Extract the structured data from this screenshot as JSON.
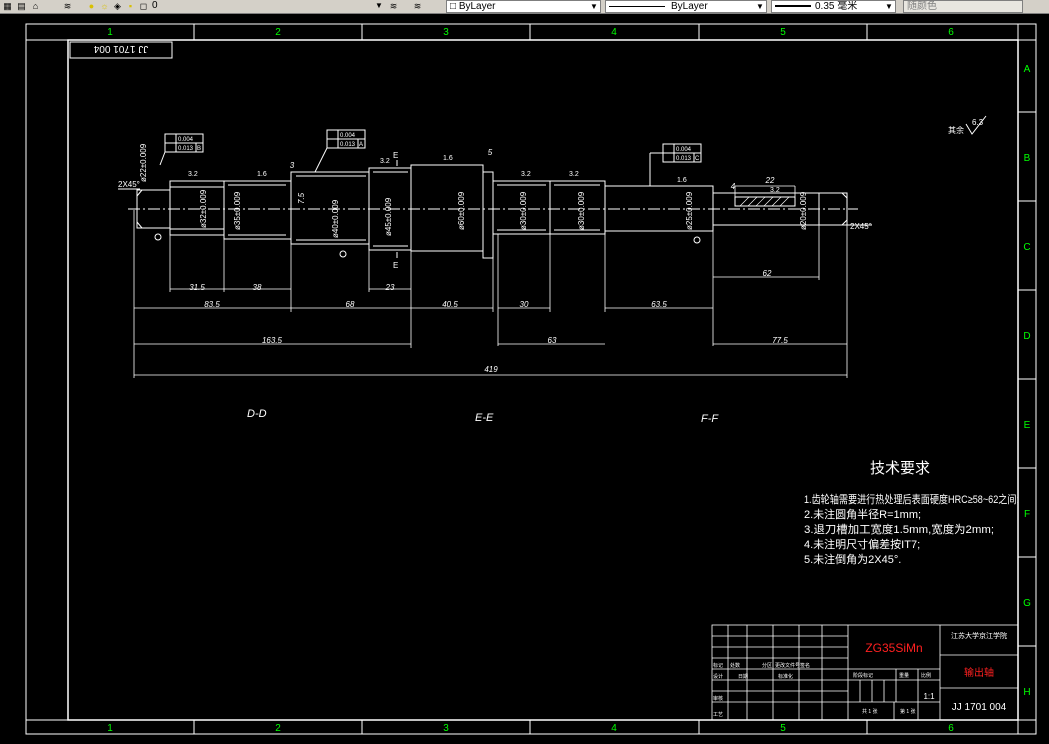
{
  "toolbar": {
    "layer_name": "0",
    "color_value": "ByLayer",
    "linetype_value": "ByLayer",
    "lineweight_value": "0.35 毫米",
    "plotstyle_value": "随颜色",
    "icons": [
      "layer-manager-icon",
      "lightbulb-icon",
      "sun-icon",
      "layer-color-icon",
      "lock-icon",
      "layer-previous-icon",
      "layer-tool-icon",
      "color-swatch-icon"
    ]
  },
  "border": {
    "columns": [
      "1",
      "2",
      "3",
      "4",
      "5",
      "6"
    ],
    "rows": [
      "A",
      "B",
      "C",
      "D",
      "E",
      "F",
      "G",
      "H"
    ]
  },
  "drawing": {
    "drawing_number_rotated": "JJ 1701 004",
    "surface_note": "其余",
    "surface_roughness": "6.3",
    "section_labels": [
      "D-D",
      "E-E",
      "F-F"
    ],
    "chamfer_left": "2X45°",
    "chamfer_right": "2X45°",
    "diameters": [
      "ø22±0.009",
      "ø32±0.009",
      "ø35±0.009",
      "ø40±0.009",
      "ø45±0.009",
      "ø60±0.009",
      "ø30±0.009",
      "ø30±0.009",
      "ø25±0.009",
      "ø20±0.009"
    ],
    "tolerance_frames": [
      {
        "values": [
          "0.004",
          "0.013"
        ],
        "datum": "B"
      },
      {
        "values": [
          "0.004",
          "0.013"
        ],
        "datum": "A"
      },
      {
        "values": [
          "0.004",
          "0.013"
        ],
        "datum": "C"
      }
    ],
    "dimensions": {
      "d31_5": "31.5",
      "d38": "38",
      "d83_5": "83.5",
      "d68": "68",
      "d23": "23",
      "d40_5": "40.5",
      "d30": "30",
      "d63_5": "63.5",
      "d163_5": "163.5",
      "d63": "63",
      "d77_5": "77.5",
      "d419": "419",
      "d62": "62",
      "d22": "22",
      "d7_5": "7.5",
      "d5": "5",
      "d3": "3",
      "d4": "4"
    },
    "roughness_marks": [
      "3.2",
      "1.6",
      "3.2",
      "1.6",
      "3.2",
      "3.2",
      "1.6",
      "3.2"
    ],
    "section_marks": [
      "E",
      "E"
    ]
  },
  "tech_requirements": {
    "title": "技术要求",
    "items": [
      "1.齿轮轴需要进行热处理后表面硬度HRC≥58~62之间;",
      "2.未注圆角半径R=1mm;",
      "3.退刀槽加工宽度1.5mm,宽度为2mm;",
      "4.未注明尺寸偏差按IT7;",
      "5.未注倒角为2X45°."
    ]
  },
  "title_block": {
    "material": "ZG35SiMn",
    "school": "江苏大学京江学院",
    "part_name": "输出轴",
    "drawing_number": "JJ 1701 004",
    "scale": "1:1",
    "row_labels": [
      "标记",
      "设计",
      "审核",
      "工艺"
    ],
    "header_cells": [
      "处数",
      "分区",
      "更改文件号",
      "签名"
    ],
    "design_cells": [
      "日期",
      "标准化"
    ],
    "stage_label": "阶段标记",
    "weight_label": "重量",
    "scale_label": "比例",
    "sheets_total": "共 1 张",
    "sheet_current": "第 1 张"
  },
  "colors": {
    "frame": "#ffffff",
    "grid_number": "#00ff00",
    "material_text": "#ff2020",
    "part_name": "#ff2020",
    "toolbar_bg": "#d4d0c8"
  }
}
